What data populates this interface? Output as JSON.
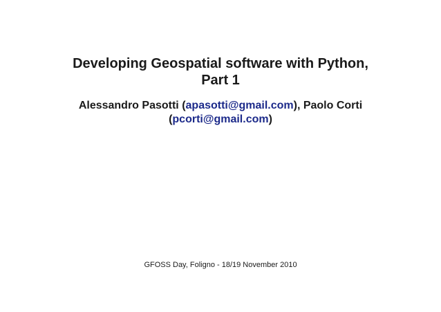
{
  "slide": {
    "title_line1": "Developing Geospatial software with Python,",
    "title_line2": "Part 1",
    "authors": {
      "author1_name": "Alessandro Pasotti",
      "author1_email": "apasotti@gmail.com",
      "author2_name": "Paolo Corti",
      "author2_email": "pcorti@gmail.com"
    },
    "footer": "GFOSS Day, Foligno - 18/19 November 2010"
  },
  "colors": {
    "text": "#1a1a1a",
    "link": "#1c2a8a",
    "background": "#ffffff"
  }
}
